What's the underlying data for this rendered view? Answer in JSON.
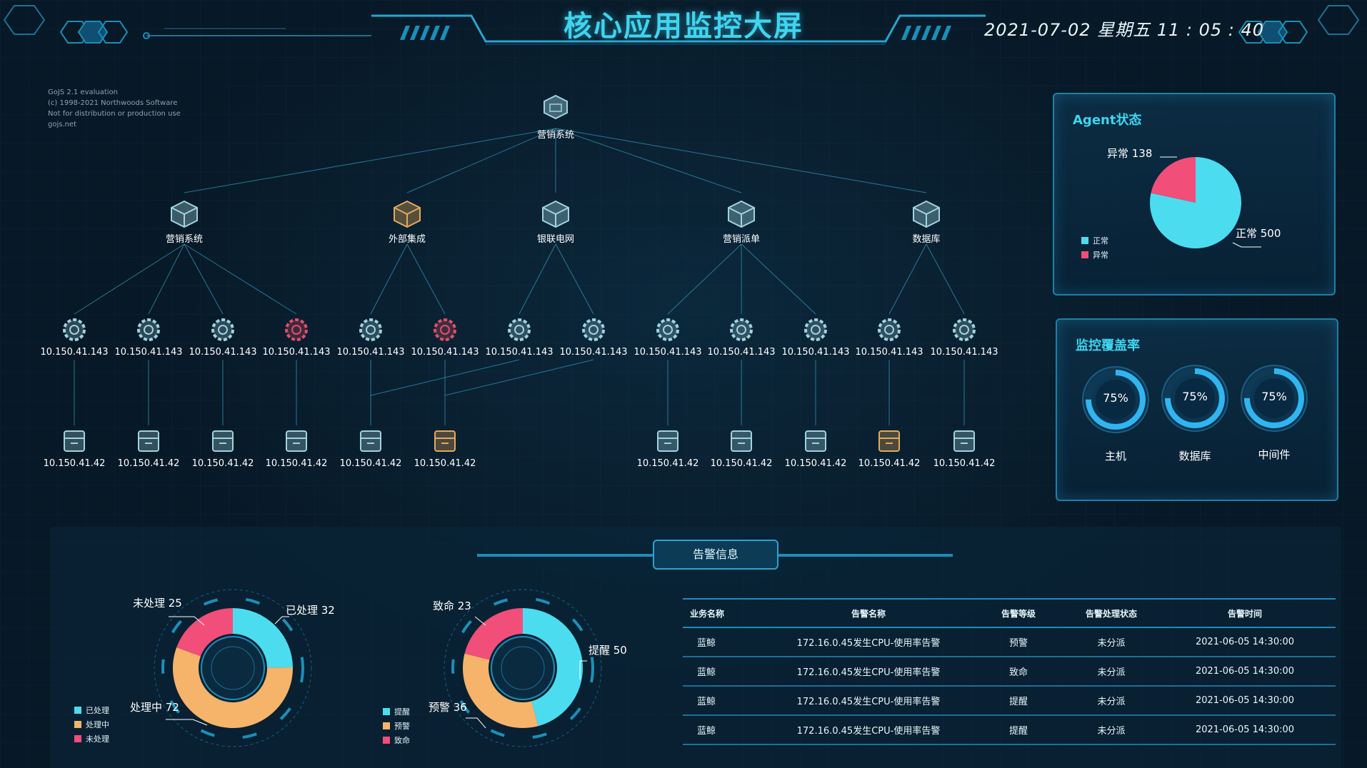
{
  "header": {
    "title": "核心应用监控大屏",
    "datetime": "2021-07-02 星期五  11 : 05 : 40"
  },
  "watermark": {
    "line1": "GoJS 2.1 evaluation",
    "line2": "(c) 1998-2021 Northwoods Software",
    "line3": "Not for distribution or production use",
    "line4": "gojs.net"
  },
  "topology": {
    "root": {
      "label": "营销系统",
      "icon": "package-icon"
    },
    "groups": [
      {
        "label": "营销系统",
        "status": "normal",
        "servers": [
          {
            "ip": "10.150.41.143",
            "status": "normal",
            "db": "10.150.41.42",
            "db_status": "normal"
          },
          {
            "ip": "10.150.41.143",
            "status": "normal",
            "db": "10.150.41.42",
            "db_status": "normal"
          },
          {
            "ip": "10.150.41.143",
            "status": "normal",
            "db": "10.150.41.42",
            "db_status": "normal"
          },
          {
            "ip": "10.150.41.143",
            "status": "alarm",
            "db": "10.150.41.42",
            "db_status": "normal"
          }
        ]
      },
      {
        "label": "外部集成",
        "status": "warning",
        "servers": [
          {
            "ip": "10.150.41.143",
            "status": "normal",
            "db": "10.150.41.42",
            "db_status": "normal"
          },
          {
            "ip": "10.150.41.143",
            "status": "alarm",
            "db": "10.150.41.42",
            "db_status": "warning"
          }
        ]
      },
      {
        "label": "银联电网",
        "status": "normal",
        "servers": [
          {
            "ip": "10.150.41.143",
            "status": "normal"
          },
          {
            "ip": "10.150.41.143",
            "status": "normal"
          }
        ]
      },
      {
        "label": "营销派单",
        "status": "normal",
        "servers": [
          {
            "ip": "10.150.41.143",
            "status": "normal",
            "db": "10.150.41.42",
            "db_status": "normal"
          },
          {
            "ip": "10.150.41.143",
            "status": "normal",
            "db": "10.150.41.42",
            "db_status": "normal"
          },
          {
            "ip": "10.150.41.143",
            "status": "normal",
            "db": "10.150.41.42",
            "db_status": "normal"
          }
        ]
      },
      {
        "label": "数据库",
        "status": "normal",
        "servers": [
          {
            "ip": "10.150.41.143",
            "status": "normal",
            "db": "10.150.41.42",
            "db_status": "warning"
          },
          {
            "ip": "10.150.41.143",
            "status": "normal",
            "db": "10.150.41.42",
            "db_status": "normal"
          }
        ]
      }
    ]
  },
  "agent": {
    "title": "Agent状态",
    "normal_label": "正常 500",
    "abnormal_label": "异常 138",
    "normal_value": 500,
    "abnormal_value": 138,
    "legend": [
      "正常",
      "异常"
    ],
    "colors": {
      "normal": "#4cdcef",
      "abnormal": "#f24e7a"
    }
  },
  "coverage": {
    "title": "监控覆盖率",
    "items": [
      {
        "name": "主机",
        "text": "75%",
        "value": 0.75
      },
      {
        "name": "数据库",
        "text": "75%",
        "value": 0.75
      },
      {
        "name": "中间件",
        "text": "75%",
        "value": 0.75
      }
    ]
  },
  "alarm": {
    "tab": "告警信息",
    "status_donut": {
      "segments": [
        {
          "name": "已处理",
          "value": 32,
          "label": "已处理 32",
          "color": "#4cdcef"
        },
        {
          "name": "处理中",
          "value": 72,
          "label": "处理中 72",
          "color": "#f6b36a"
        },
        {
          "name": "未处理",
          "value": 25,
          "label": "未处理 25",
          "color": "#f24e7a"
        }
      ]
    },
    "level_donut": {
      "segments": [
        {
          "name": "提醒",
          "value": 50,
          "label": "提醒 50",
          "color": "#4cdcef"
        },
        {
          "name": "预警",
          "value": 36,
          "label": "预警 36",
          "color": "#f6b36a"
        },
        {
          "name": "致命",
          "value": 23,
          "label": "致命 23",
          "color": "#f24e7a"
        }
      ]
    },
    "table": {
      "headers": [
        "业务名称",
        "告警名称",
        "告警等级",
        "告警处理状态",
        "告警时间"
      ],
      "rows": [
        [
          "蓝鲸",
          "172.16.0.45发生CPU-使用率告警",
          "预警",
          "未分派",
          "2021-06-05 14:30:00"
        ],
        [
          "蓝鲸",
          "172.16.0.45发生CPU-使用率告警",
          "致命",
          "未分派",
          "2021-06-05 14:30:00"
        ],
        [
          "蓝鲸",
          "172.16.0.45发生CPU-使用率告警",
          "提醒",
          "未分派",
          "2021-06-05 14:30:00"
        ],
        [
          "蓝鲸",
          "172.16.0.45发生CPU-使用率告警",
          "提醒",
          "未分派",
          "2021-06-05 14:30:00"
        ]
      ]
    }
  }
}
